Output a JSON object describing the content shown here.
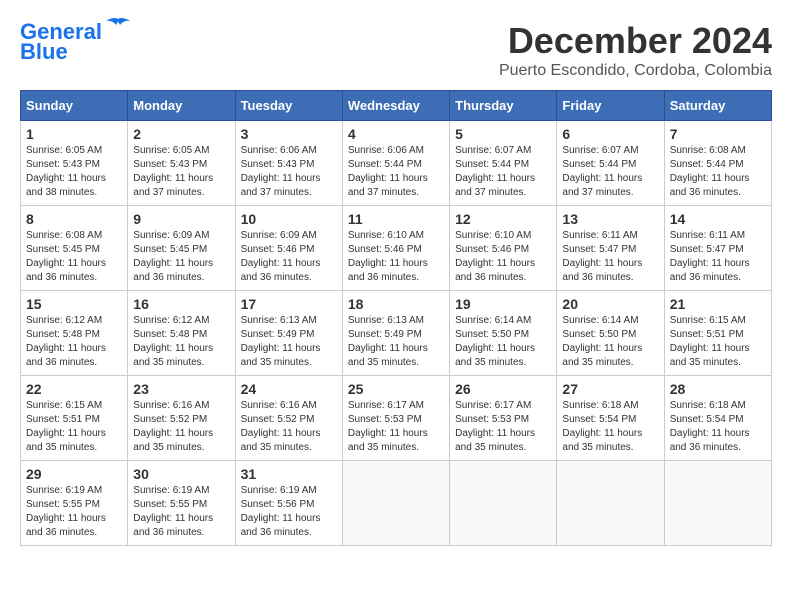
{
  "logo": {
    "line1": "General",
    "line2": "Blue"
  },
  "title": "December 2024",
  "location": "Puerto Escondido, Cordoba, Colombia",
  "weekdays": [
    "Sunday",
    "Monday",
    "Tuesday",
    "Wednesday",
    "Thursday",
    "Friday",
    "Saturday"
  ],
  "weeks": [
    [
      {
        "day": "1",
        "sunrise": "6:05 AM",
        "sunset": "5:43 PM",
        "daylight": "11 hours and 38 minutes."
      },
      {
        "day": "2",
        "sunrise": "6:05 AM",
        "sunset": "5:43 PM",
        "daylight": "11 hours and 37 minutes."
      },
      {
        "day": "3",
        "sunrise": "6:06 AM",
        "sunset": "5:43 PM",
        "daylight": "11 hours and 37 minutes."
      },
      {
        "day": "4",
        "sunrise": "6:06 AM",
        "sunset": "5:44 PM",
        "daylight": "11 hours and 37 minutes."
      },
      {
        "day": "5",
        "sunrise": "6:07 AM",
        "sunset": "5:44 PM",
        "daylight": "11 hours and 37 minutes."
      },
      {
        "day": "6",
        "sunrise": "6:07 AM",
        "sunset": "5:44 PM",
        "daylight": "11 hours and 37 minutes."
      },
      {
        "day": "7",
        "sunrise": "6:08 AM",
        "sunset": "5:44 PM",
        "daylight": "11 hours and 36 minutes."
      }
    ],
    [
      {
        "day": "8",
        "sunrise": "6:08 AM",
        "sunset": "5:45 PM",
        "daylight": "11 hours and 36 minutes."
      },
      {
        "day": "9",
        "sunrise": "6:09 AM",
        "sunset": "5:45 PM",
        "daylight": "11 hours and 36 minutes."
      },
      {
        "day": "10",
        "sunrise": "6:09 AM",
        "sunset": "5:46 PM",
        "daylight": "11 hours and 36 minutes."
      },
      {
        "day": "11",
        "sunrise": "6:10 AM",
        "sunset": "5:46 PM",
        "daylight": "11 hours and 36 minutes."
      },
      {
        "day": "12",
        "sunrise": "6:10 AM",
        "sunset": "5:46 PM",
        "daylight": "11 hours and 36 minutes."
      },
      {
        "day": "13",
        "sunrise": "6:11 AM",
        "sunset": "5:47 PM",
        "daylight": "11 hours and 36 minutes."
      },
      {
        "day": "14",
        "sunrise": "6:11 AM",
        "sunset": "5:47 PM",
        "daylight": "11 hours and 36 minutes."
      }
    ],
    [
      {
        "day": "15",
        "sunrise": "6:12 AM",
        "sunset": "5:48 PM",
        "daylight": "11 hours and 36 minutes."
      },
      {
        "day": "16",
        "sunrise": "6:12 AM",
        "sunset": "5:48 PM",
        "daylight": "11 hours and 35 minutes."
      },
      {
        "day": "17",
        "sunrise": "6:13 AM",
        "sunset": "5:49 PM",
        "daylight": "11 hours and 35 minutes."
      },
      {
        "day": "18",
        "sunrise": "6:13 AM",
        "sunset": "5:49 PM",
        "daylight": "11 hours and 35 minutes."
      },
      {
        "day": "19",
        "sunrise": "6:14 AM",
        "sunset": "5:50 PM",
        "daylight": "11 hours and 35 minutes."
      },
      {
        "day": "20",
        "sunrise": "6:14 AM",
        "sunset": "5:50 PM",
        "daylight": "11 hours and 35 minutes."
      },
      {
        "day": "21",
        "sunrise": "6:15 AM",
        "sunset": "5:51 PM",
        "daylight": "11 hours and 35 minutes."
      }
    ],
    [
      {
        "day": "22",
        "sunrise": "6:15 AM",
        "sunset": "5:51 PM",
        "daylight": "11 hours and 35 minutes."
      },
      {
        "day": "23",
        "sunrise": "6:16 AM",
        "sunset": "5:52 PM",
        "daylight": "11 hours and 35 minutes."
      },
      {
        "day": "24",
        "sunrise": "6:16 AM",
        "sunset": "5:52 PM",
        "daylight": "11 hours and 35 minutes."
      },
      {
        "day": "25",
        "sunrise": "6:17 AM",
        "sunset": "5:53 PM",
        "daylight": "11 hours and 35 minutes."
      },
      {
        "day": "26",
        "sunrise": "6:17 AM",
        "sunset": "5:53 PM",
        "daylight": "11 hours and 35 minutes."
      },
      {
        "day": "27",
        "sunrise": "6:18 AM",
        "sunset": "5:54 PM",
        "daylight": "11 hours and 35 minutes."
      },
      {
        "day": "28",
        "sunrise": "6:18 AM",
        "sunset": "5:54 PM",
        "daylight": "11 hours and 36 minutes."
      }
    ],
    [
      {
        "day": "29",
        "sunrise": "6:19 AM",
        "sunset": "5:55 PM",
        "daylight": "11 hours and 36 minutes."
      },
      {
        "day": "30",
        "sunrise": "6:19 AM",
        "sunset": "5:55 PM",
        "daylight": "11 hours and 36 minutes."
      },
      {
        "day": "31",
        "sunrise": "6:19 AM",
        "sunset": "5:56 PM",
        "daylight": "11 hours and 36 minutes."
      },
      null,
      null,
      null,
      null
    ]
  ]
}
